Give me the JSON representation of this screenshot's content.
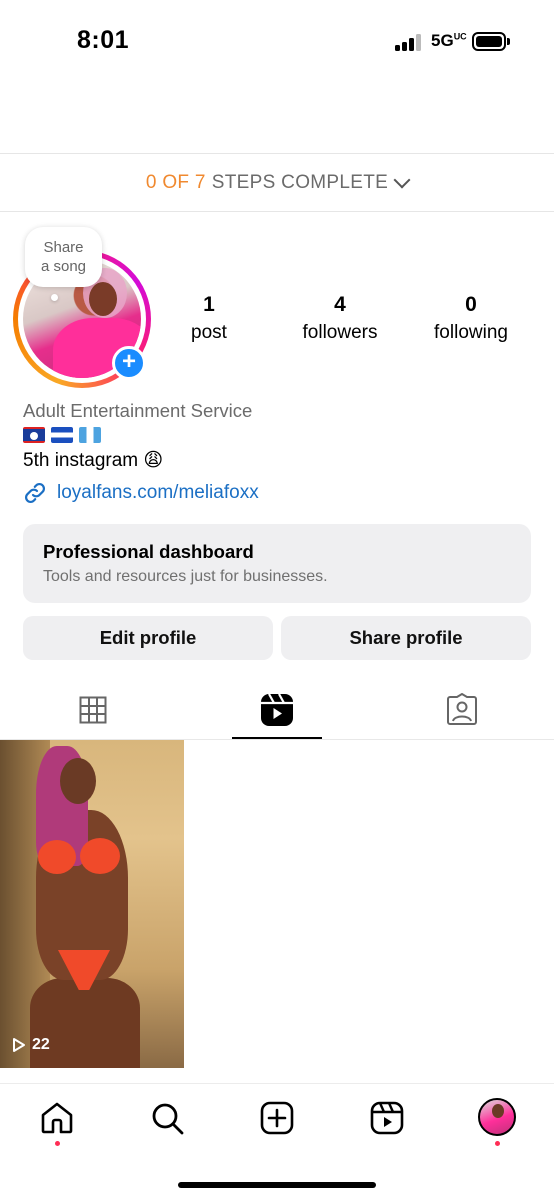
{
  "status_bar": {
    "time": "8:01",
    "network": "5G",
    "network_superscript": "UC",
    "battery_level": 1.0
  },
  "setup": {
    "progress_text": "0 OF 7",
    "suffix_text": "STEPS COMPLETE"
  },
  "profile": {
    "share_song_line1": "Share",
    "share_song_line2": "a song",
    "stats": {
      "posts_count": "1",
      "posts_label": "post",
      "followers_count": "4",
      "followers_label": "followers",
      "following_count": "0",
      "following_label": "following"
    },
    "category": "Adult Entertainment Service",
    "flags": [
      "belize-flag",
      "honduras-flag",
      "guatemala-flag"
    ],
    "bio": "5th instagram 😩",
    "link": "loyalfans.com/meliafoxx"
  },
  "dashboard": {
    "title": "Professional dashboard",
    "subtitle": "Tools and resources just for businesses."
  },
  "actions": {
    "edit_label": "Edit profile",
    "share_label": "Share profile"
  },
  "tabs": {
    "items": [
      "grid-icon",
      "reels-icon",
      "tagged-icon"
    ],
    "active": "reels-icon"
  },
  "grid": {
    "posts": [
      {
        "type": "reel",
        "views": "22"
      }
    ]
  },
  "bottom_nav": {
    "items": [
      "home-icon",
      "search-icon",
      "create-icon",
      "reels-icon",
      "profile-avatar"
    ],
    "active": "profile-avatar"
  },
  "colors": {
    "accent_orange": "#f0892f",
    "link_blue": "#1b6fc4",
    "badge_blue": "#1a8cff",
    "notification_red": "#ff2d55",
    "button_gray": "#efeff1"
  }
}
